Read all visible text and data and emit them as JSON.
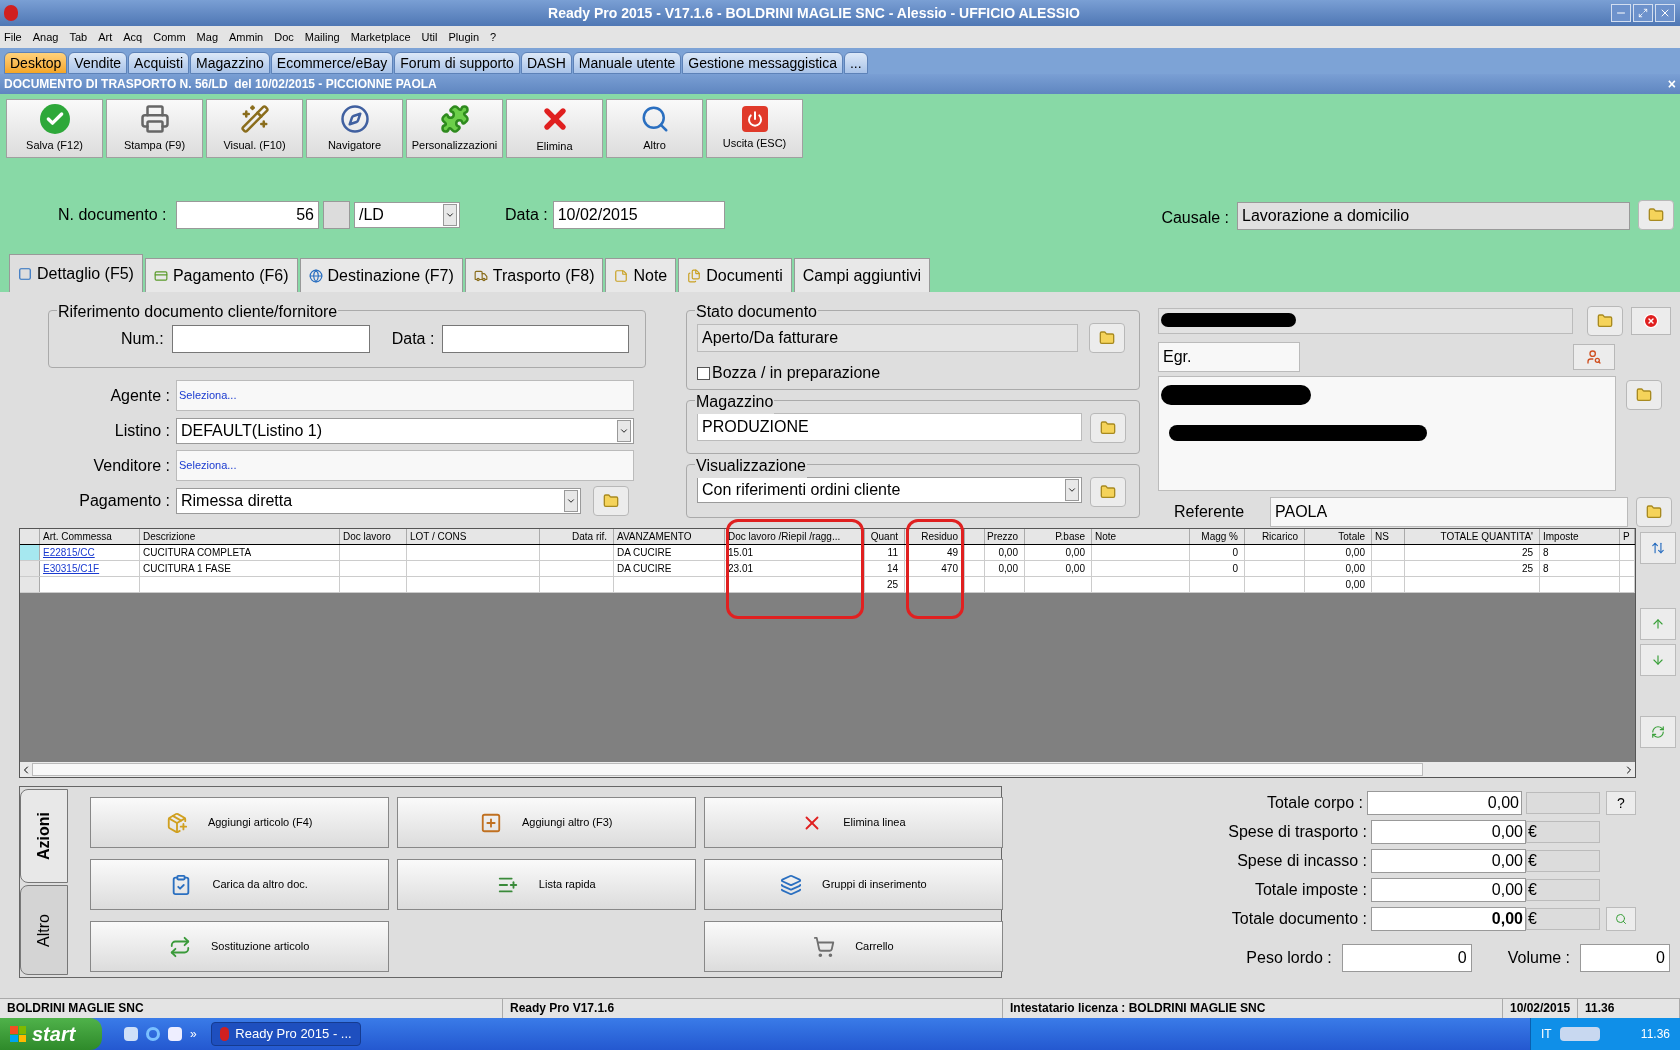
{
  "window": {
    "title": "Ready Pro 2015 - V17.1.6 - BOLDRINI MAGLIE SNC - Alessio - UFFICIO ALESSIO"
  },
  "menu": [
    "File",
    "Anag",
    "Tab",
    "Art",
    "Acq",
    "Comm",
    "Mag",
    "Ammin",
    "Doc",
    "Mailing",
    "Marketplace",
    "Util",
    "Plugin",
    "?"
  ],
  "app_tabs": [
    {
      "label": "Desktop",
      "selected": true
    },
    {
      "label": "Vendite",
      "selected": false
    },
    {
      "label": "Acquisti",
      "selected": false
    },
    {
      "label": "Magazzino",
      "selected": false
    },
    {
      "label": "Ecommerce/eBay",
      "selected": false
    },
    {
      "label": "Forum di supporto",
      "selected": false
    },
    {
      "label": "DASH",
      "selected": false
    },
    {
      "label": "Manuale utente",
      "selected": false
    },
    {
      "label": "Gestione messaggistica",
      "selected": false
    },
    {
      "label": "...",
      "selected": false
    }
  ],
  "document_title": "DOCUMENTO DI TRASPORTO N. 56/LD  del 10/02/2015 - PICCIONNE PAOLA",
  "close_mark": "×",
  "toolbar": [
    {
      "kind": "save",
      "label": "Salva (F12)"
    },
    {
      "kind": "print",
      "label": "Stampa (F9)"
    },
    {
      "kind": "view",
      "label": "Visual. (F10)"
    },
    {
      "kind": "navigator",
      "label": "Navigatore"
    },
    {
      "kind": "custom",
      "label": "Personalizzazioni"
    },
    {
      "kind": "delete",
      "label": "Elimina"
    },
    {
      "kind": "other",
      "label": "Altro"
    },
    {
      "kind": "exit",
      "label": "Uscita (ESC)"
    }
  ],
  "header": {
    "number_label": "N. documento :",
    "number": "56",
    "series": "/LD",
    "date_label": "Data :",
    "date": "10/02/2015",
    "causale_label": "Causale :",
    "causale": "Lavorazione a domicilio"
  },
  "detail_tabs": [
    {
      "kind": "detail",
      "label": "Dettaglio (F5)",
      "selected": true
    },
    {
      "kind": "payment",
      "label": "Pagamento (F6)",
      "selected": false
    },
    {
      "kind": "destination",
      "label": "Destinazione (F7)",
      "selected": false
    },
    {
      "kind": "transport",
      "label": "Trasporto (F8)",
      "selected": false
    },
    {
      "kind": "note",
      "label": "Note",
      "selected": false
    },
    {
      "kind": "docs",
      "label": "Documenti",
      "selected": false
    },
    {
      "kind": "plain",
      "label": "Campi aggiuntivi",
      "selected": false
    }
  ],
  "reference": {
    "title": "Riferimento documento cliente/fornitore",
    "num_label": "Num.:",
    "date_label": "Data :"
  },
  "fields": [
    {
      "kind": "link",
      "label": "Agente :",
      "value": "Seleziona..."
    },
    {
      "kind": "combo",
      "label": "Listino :",
      "value": "DEFAULT(Listino 1)"
    },
    {
      "kind": "link",
      "label": "Venditore :",
      "value": "Seleziona..."
    },
    {
      "kind": "combo_folder",
      "label": "Pagamento :",
      "value": "Rimessa diretta"
    }
  ],
  "status": {
    "title": "Stato documento",
    "value": "Aperto/Da fatturare",
    "draft_label": "Bozza / in preparazione",
    "draft_checked": false
  },
  "warehouse": {
    "title": "Magazzino",
    "value": "PRODUZIONE"
  },
  "view": {
    "title": "Visualizzazione",
    "value": "Con riferimenti ordini cliente"
  },
  "customer": {
    "title_value": "Egr.",
    "referente_label": "Referente",
    "referente": "PAOLA"
  },
  "grid": {
    "columns": [
      {
        "label": "Art. Commessa",
        "highlighted": false
      },
      {
        "label": "Descrizione",
        "highlighted": false
      },
      {
        "label": "Doc lavoro",
        "highlighted": false
      },
      {
        "label": "LOT / CONS",
        "highlighted": false
      },
      {
        "label": "Data rif.",
        "highlighted": false
      },
      {
        "label": "AVANZAMENTO",
        "highlighted": false
      },
      {
        "label": "Doc lavoro /Riepil /ragg...",
        "highlighted": true
      },
      {
        "label": "Quant",
        "highlighted": false
      },
      {
        "label": "Residuo",
        "highlighted": true
      },
      {
        "highlighted": false
      },
      {
        "label": "Prezzo",
        "highlighted": false
      },
      {
        "label": "P.base",
        "highlighted": false
      },
      {
        "label": "Note",
        "highlighted": false
      },
      {
        "label": "Magg %",
        "highlighted": false
      },
      {
        "label": "Ricarico",
        "highlighted": false
      },
      {
        "label": "Totale",
        "highlighted": false
      },
      {
        "label": "NS",
        "highlighted": false
      },
      {
        "label": "TOTALE QUANTITA'",
        "highlighted": false
      },
      {
        "label": "Imposte",
        "highlighted": false
      },
      {
        "label": "P",
        "highlighted": false
      }
    ],
    "rows": [
      {
        "selected": true,
        "cells": [
          "E22815/CC",
          "CUCITURA COMPLETA",
          null,
          null,
          null,
          "DA CUCIRE",
          "15.01",
          "11",
          "49",
          null,
          "0,00",
          "0,00",
          null,
          "0",
          null,
          "0,00",
          null,
          "25",
          "8",
          null
        ]
      },
      {
        "selected": false,
        "cells": [
          "E30315/C1F",
          "CUCITURA 1 FASE",
          null,
          null,
          null,
          "DA CUCIRE",
          "23.01",
          "14",
          "470",
          null,
          "0,00",
          "0,00",
          null,
          "0",
          null,
          "0,00",
          null,
          "25",
          "8",
          null
        ]
      },
      {
        "selected": false,
        "cells": [
          null,
          null,
          null,
          null,
          null,
          null,
          null,
          "25",
          null,
          null,
          null,
          null,
          null,
          null,
          null,
          "0,00",
          null,
          null,
          null,
          null
        ]
      }
    ]
  },
  "side_tabs": [
    {
      "label": "Azioni",
      "selected": true
    },
    {
      "label": "Altro",
      "selected": false
    }
  ],
  "actions": [
    {
      "kind": "add",
      "label": "Aggiungi articolo (F4)"
    },
    {
      "kind": "add_other",
      "label": "Aggiungi altro (F3)"
    },
    {
      "kind": "delete",
      "label": "Elimina linea"
    },
    {
      "kind": "load",
      "label": "Carica da altro doc."
    },
    {
      "kind": "list",
      "label": "Lista rapida"
    },
    {
      "kind": "groups",
      "label": "Gruppi di inserimento"
    },
    {
      "kind": "replace",
      "label": "Sostituzione articolo"
    },
    {
      "kind": "empty"
    },
    {
      "kind": "cart",
      "label": "Carrello"
    }
  ],
  "totals": [
    {
      "kind": "help",
      "label": "Totale corpo :",
      "value": "0,00",
      "extra": "?",
      "emphasis": false
    },
    {
      "kind": "currency",
      "label": "Spese di trasporto :",
      "value": "0,00",
      "extra": "€",
      "emphasis": false
    },
    {
      "kind": "currency",
      "label": "Spese di incasso :",
      "value": "0,00",
      "extra": "€",
      "emphasis": false
    },
    {
      "kind": "currency",
      "label": "Totale imposte :",
      "value": "0,00",
      "extra": "€",
      "emphasis": false
    },
    {
      "kind": "lookup",
      "label": "Totale documento :",
      "value": "0,00",
      "extra": "€",
      "emphasis": true
    }
  ],
  "weight": {
    "label": "Peso lordo :",
    "value": "0",
    "volume_label": "Volume :",
    "volume": "0"
  },
  "status_bar": [
    "BOLDRINI MAGLIE SNC",
    "Ready Pro V17.1.6",
    "Intestatario licenza : BOLDRINI MAGLIE SNC",
    "10/02/2015",
    "11.36"
  ],
  "taskbar": {
    "start": "start",
    "quick_more": "»",
    "task": "Ready Pro 2015 - ...",
    "language": "IT",
    "clock": "11.36"
  }
}
